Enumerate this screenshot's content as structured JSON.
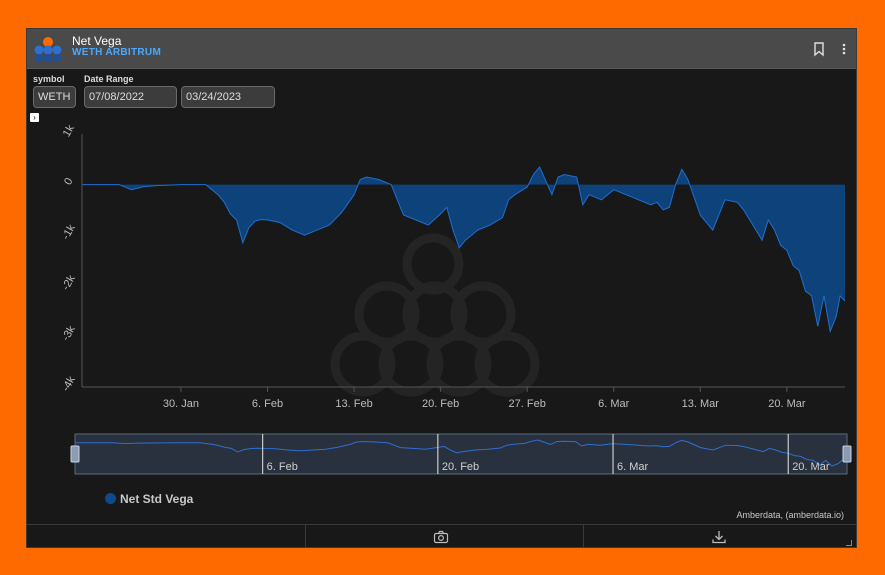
{
  "widget": {
    "title": "Net Vega",
    "subtitle": "WETH ARBITRUM"
  },
  "params": {
    "symbol_label": "symbol",
    "symbol_value": "WETH",
    "date_range_label": "Date Range",
    "start_date": "07/08/2022",
    "end_date": "03/24/2023"
  },
  "icons": {
    "bookmark": "bookmark-icon",
    "more": "more-vertical-icon",
    "expand": "chevron-right-icon",
    "camera": "camera-icon",
    "download": "download-icon"
  },
  "colors": {
    "series": "#0d4a8c",
    "series_line": "#1f6fd1",
    "background": "#181818",
    "border": "#ff6a00"
  },
  "chart_data": {
    "type": "area",
    "y_tick_labels": [
      "1k",
      "0",
      "-1k",
      "-2k",
      "-3k",
      "-4k"
    ],
    "y_ticks": [
      1000,
      0,
      -1000,
      -2000,
      -3000,
      -4000
    ],
    "ylim": [
      -4000,
      1000
    ],
    "x_tick_labels": [
      "30. Jan",
      "6. Feb",
      "13. Feb",
      "20. Feb",
      "27. Feb",
      "6. Mar",
      "13. Mar",
      "20. Mar"
    ],
    "x_tick_days": [
      29,
      36,
      43,
      50,
      57,
      64,
      71,
      78
    ],
    "xlim_days": [
      21,
      82.7
    ],
    "navigator_labels": [
      "6. Feb",
      "20. Feb",
      "6. Mar",
      "20. Mar"
    ],
    "navigator_label_days": [
      36,
      50,
      64,
      78
    ],
    "series": [
      {
        "name": "Net Std Vega",
        "x_days": [
          21,
          24,
          25,
          26,
          27,
          29,
          31,
          32,
          32.5,
          33,
          33.5,
          34,
          34.5,
          35,
          35.5,
          36,
          37,
          38,
          39,
          40,
          41,
          42,
          43,
          43.5,
          44,
          45,
          46,
          46.5,
          47,
          48,
          49,
          50,
          50.5,
          51,
          51.5,
          52,
          53,
          54,
          55,
          55.5,
          56,
          57,
          57.5,
          58,
          59,
          59.5,
          60,
          61,
          61.5,
          62,
          63,
          64,
          65,
          66,
          67,
          67.5,
          68,
          68.5,
          69,
          69.5,
          70,
          71,
          72,
          73,
          74,
          74.5,
          75,
          76,
          76.5,
          77,
          77.5,
          78,
          78.5,
          79,
          79.5,
          80,
          80.5,
          81,
          81.5,
          82,
          82.3,
          82.7
        ],
        "values": [
          0,
          0,
          -100,
          -40,
          -20,
          0,
          0,
          -200,
          -350,
          -580,
          -700,
          -1150,
          -850,
          -720,
          -690,
          -700,
          -750,
          -900,
          -1000,
          -900,
          -800,
          -550,
          -200,
          100,
          150,
          100,
          0,
          -300,
          -600,
          -700,
          -800,
          -580,
          -450,
          -900,
          -1250,
          -1100,
          -900,
          -800,
          -650,
          -300,
          -200,
          -50,
          200,
          350,
          -200,
          150,
          200,
          150,
          -400,
          -200,
          -300,
          -100,
          -200,
          -300,
          -400,
          -350,
          -500,
          -450,
          0,
          300,
          100,
          -600,
          -900,
          -300,
          -350,
          -500,
          -700,
          -1100,
          -700,
          -900,
          -1200,
          -1300,
          -1600,
          -1700,
          -2100,
          -2200,
          -2800,
          -2200,
          -2900,
          -2600,
          -2200,
          -2300
        ]
      }
    ],
    "legend": "bottom-left",
    "grid": false
  },
  "credits": "Amberdata, (amberdata.io)"
}
